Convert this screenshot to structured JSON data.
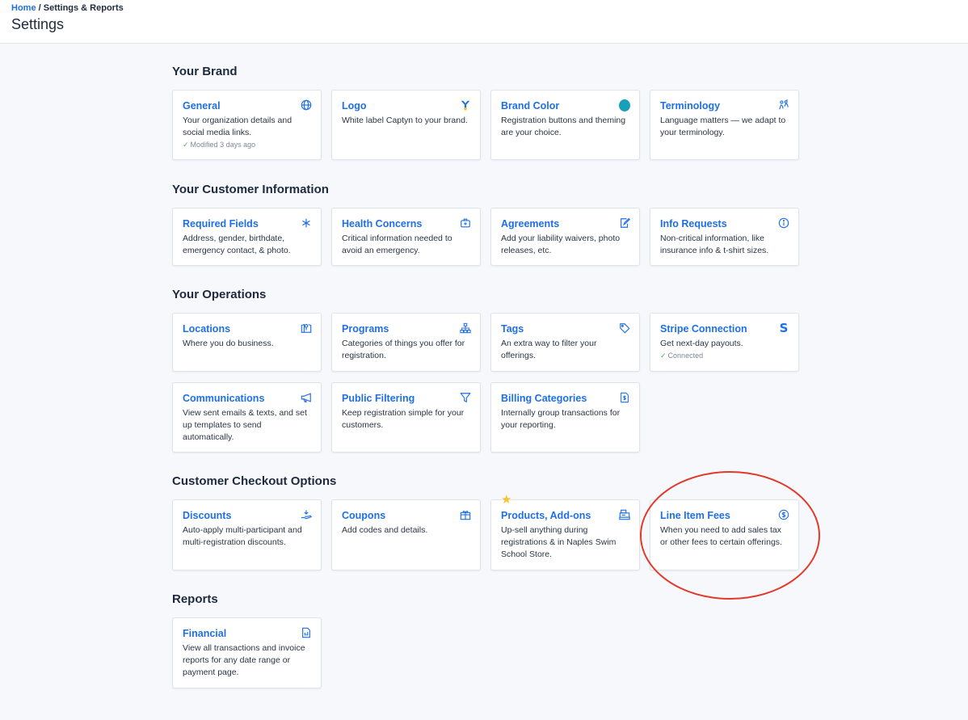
{
  "breadcrumb": {
    "home": "Home",
    "separator": " / ",
    "current": "Settings & Reports"
  },
  "page_title": "Settings",
  "sections": {
    "brand": {
      "title": "Your Brand",
      "cards": [
        {
          "title": "General",
          "desc": "Your organization details and social media links.",
          "status": "Modified 3 days ago",
          "icon": "globe-icon"
        },
        {
          "title": "Logo",
          "desc": "White label Captyn to your brand.",
          "icon": "captyn-logo-icon",
          "icon_color": "#1f6fe5"
        },
        {
          "title": "Brand Color",
          "desc": "Registration buttons and theming are your choice.",
          "icon": "color-swatch-icon",
          "swatch": "#1a9fb8"
        },
        {
          "title": "Terminology",
          "desc": "Language matters — we adapt to your terminology.",
          "icon": "people-icon"
        }
      ]
    },
    "customer_info": {
      "title": "Your Customer Information",
      "cards": [
        {
          "title": "Required Fields",
          "desc": "Address, gender, birthdate, emergency contact, & photo.",
          "icon": "asterisk-icon"
        },
        {
          "title": "Health Concerns",
          "desc": "Critical information needed to avoid an emergency.",
          "icon": "medkit-icon"
        },
        {
          "title": "Agreements",
          "desc": "Add your liability waivers, photo releases, etc.",
          "icon": "signature-icon"
        },
        {
          "title": "Info Requests",
          "desc": "Non-critical information, like insurance info & t-shirt sizes.",
          "icon": "info-icon"
        }
      ]
    },
    "operations": {
      "title": "Your Operations",
      "cards": [
        {
          "title": "Locations",
          "desc": "Where you do business.",
          "icon": "map-pin-icon"
        },
        {
          "title": "Programs",
          "desc": "Categories of things you offer for registration.",
          "icon": "hierarchy-icon"
        },
        {
          "title": "Tags",
          "desc": "An extra way to filter your offerings.",
          "icon": "tag-icon"
        },
        {
          "title": "Stripe Connection",
          "desc": "Get next-day payouts.",
          "status": "Connected",
          "icon": "stripe-icon",
          "icon_text": "S"
        },
        {
          "title": "Communications",
          "desc": "View sent emails & texts, and set up templates to send automatically.",
          "icon": "megaphone-icon"
        },
        {
          "title": "Public Filtering",
          "desc": "Keep registration simple for your customers.",
          "icon": "filter-icon"
        },
        {
          "title": "Billing Categories",
          "desc": "Internally group transactions for your reporting.",
          "icon": "invoice-icon"
        }
      ]
    },
    "checkout": {
      "title": "Customer Checkout Options",
      "cards": [
        {
          "title": "Discounts",
          "desc": "Auto-apply multi-participant and multi-registration discounts.",
          "icon": "hand-coin-icon"
        },
        {
          "title": "Coupons",
          "desc": "Add codes and details.",
          "icon": "gift-icon"
        },
        {
          "title": "Products, Add-ons",
          "desc": "Up-sell anything during registrations & in Naples Swim School Store.",
          "icon": "register-icon",
          "featured_icon": "star-icon"
        },
        {
          "title": "Line Item Fees",
          "desc": "When you need to add sales tax or other fees to certain offerings.",
          "icon": "dollar-circle-icon"
        }
      ]
    },
    "reports": {
      "title": "Reports",
      "cards": [
        {
          "title": "Financial",
          "desc": "View all transactions and invoice reports for any date range or payment page.",
          "icon": "document-icon"
        }
      ]
    }
  },
  "colors": {
    "accent": "#1f6fe5",
    "annotation": "#e23a2a",
    "success": "#39b56a",
    "star": "#f6c42c"
  }
}
